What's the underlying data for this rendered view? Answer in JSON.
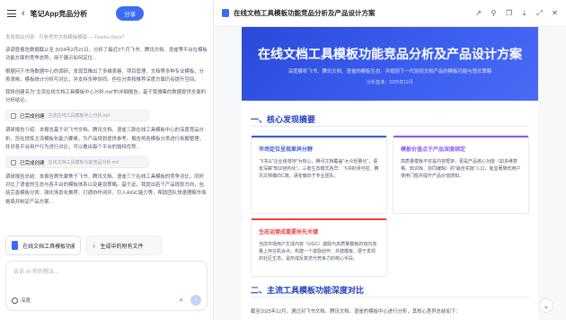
{
  "chat": {
    "title": "笔记App竞品分析",
    "share_label": "分享",
    "messages": [
      {
        "text": "发现相关内容 · 可参考的文档模板模版 — Feishu Docs?",
        "faint": true
      },
      {
        "text": "该调查报告数据截止至 2024年2月21日，分析了最近3个月飞书、腾讯文档、语雀等平台在模板功能方面的竞争态势，用于展示如何定位...",
        "faint": false
      },
      {
        "text": "根据问下市场数据中心的调研，发现其推出了多维表格、项目管理、文档等多种专业模板，分类清晰，模板统计分析可对比，并支持多种协同。但在分类和推荐深度方面仍有提升空间。",
        "faint": false
      },
      {
        "text": "我将创建名为\"主流在线文档工具模板中心分析.md\"的详细报告，基于我搜集的数据提供全面的分析结论。",
        "faint": false
      }
    ],
    "chip1": {
      "done": "已完成创建",
      "text": "主流在线工具模板中心分析.md"
    },
    "messages2": [
      {
        "text": "调研报告介绍：本报告基于对飞书文档、腾讯文档、语雀三款在线工具模板中心的深度竞品分析，旨在提炼主流模板化能力要素，为产品规划提供参考。报告将各模板分类进行拆解整理，并对各平台用户行为进行对比，可以看出每个平台的独特优势...",
        "faint": false
      }
    ],
    "chip2": {
      "done": "已完成创建",
      "text": "在线文档工具模板功能竞品分析.md"
    },
    "messages3": [
      {
        "text": "调研报告总结：本报告首先聚焦于飞书、腾讯文档、语雀三个在线工具模板的竞争对比，同时对比了语雀的生态与各平台的模板体系以及建设策略。基于此，我提出若干产品规划方向，包括完善模板分类、强化场景化推荐、打通协作闭环、引入AIGC能力等，帮助团队快速理解市场格局并制定产品方案...",
        "faint": false
      }
    ],
    "files": [
      {
        "name": "在线文档工具模板功能..."
      },
      {
        "name": "生成中的附有文件"
      }
    ],
    "input_placeholder": "告诉 AI 你的想法...",
    "think_label": "深度"
  },
  "doc": {
    "header_title": "在线文档工具模板功能竞品分析及产品设计方案",
    "hero_title": "在线文档工具模板功能竞品分析及产品设计方案",
    "hero_subtitle": "深度解析飞书、腾讯文档、语雀的模板生态，并规划下一代协同文档产品的模板功能与增长策略",
    "hero_date": "分析基准：2025年12月",
    "section1": "一、核心发现摘要",
    "cards": [
      {
        "title": "市场定位呈现差异分野",
        "color": "#3b5bdb",
        "text": "飞书以\"企业级落地\"为核心，腾讯文档覆盖\"大众轻量化\"，语雀深耕\"知识结构化\"，三者生态模式各异：飞书封闭可控、腾讯文档偏向C端，语雀偏向于专业团队。"
      },
      {
        "title": "模板价值点于产品深度绑定",
        "color": "#8b5cf6",
        "text": "高质量模板不仅是内容框架，更是产品核心功能（如多维表格、知识库、协同编辑）的\"最佳实践\"入口，能显著降低用户使用门槛并提升产品价值感知。"
      },
      {
        "title": "生态运营成重要抢先关键",
        "color": "#ef4444",
        "text": "当前市场用户生成内容（UGC）激励与高质量模板的双向流量上存在机会点，构建一个激励创作、共建模板、便于发现的社区生态，是形成反复迭代竞争力的核心手段。"
      }
    ],
    "section2": "二、主流工具模板功能深度对比",
    "summary": "截至2025年12月，通过对飞书文档、腾讯文档、语雀的模板中心进行分析，其核心差异总结如下："
  }
}
